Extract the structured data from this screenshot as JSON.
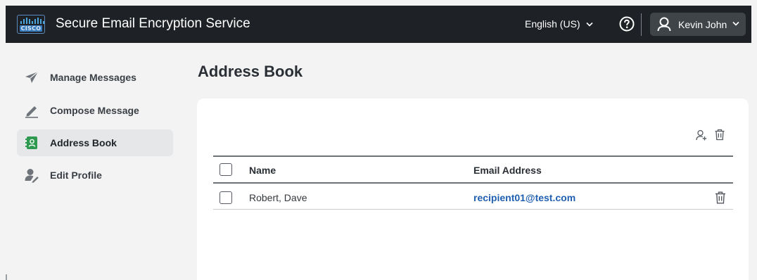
{
  "header": {
    "logo_text": "CISCO",
    "title": "Secure Email Encryption Service",
    "language": "English (US)",
    "help_icon": "question-circle-icon",
    "user_name": "Kevin John"
  },
  "sidebar": {
    "items": [
      {
        "label": "Manage Messages",
        "icon": "paper-plane-icon",
        "active": false
      },
      {
        "label": "Compose Message",
        "icon": "pencil-icon",
        "active": false
      },
      {
        "label": "Address Book",
        "icon": "address-book-icon",
        "active": true
      },
      {
        "label": "Edit Profile",
        "icon": "user-edit-icon",
        "active": false
      }
    ]
  },
  "main": {
    "title": "Address Book",
    "toolbar": {
      "add_icon": "add-user-icon",
      "delete_icon": "trash-icon"
    },
    "table": {
      "columns": [
        "Name",
        "Email Address"
      ],
      "rows": [
        {
          "name": "Robert, Dave",
          "email": "recipient01@test.com"
        }
      ]
    }
  },
  "colors": {
    "topbar": "#1e2125",
    "accent_link": "#1f5fb0",
    "active_nav": "#e6e7e9",
    "page_bg": "#f3f3f3"
  }
}
